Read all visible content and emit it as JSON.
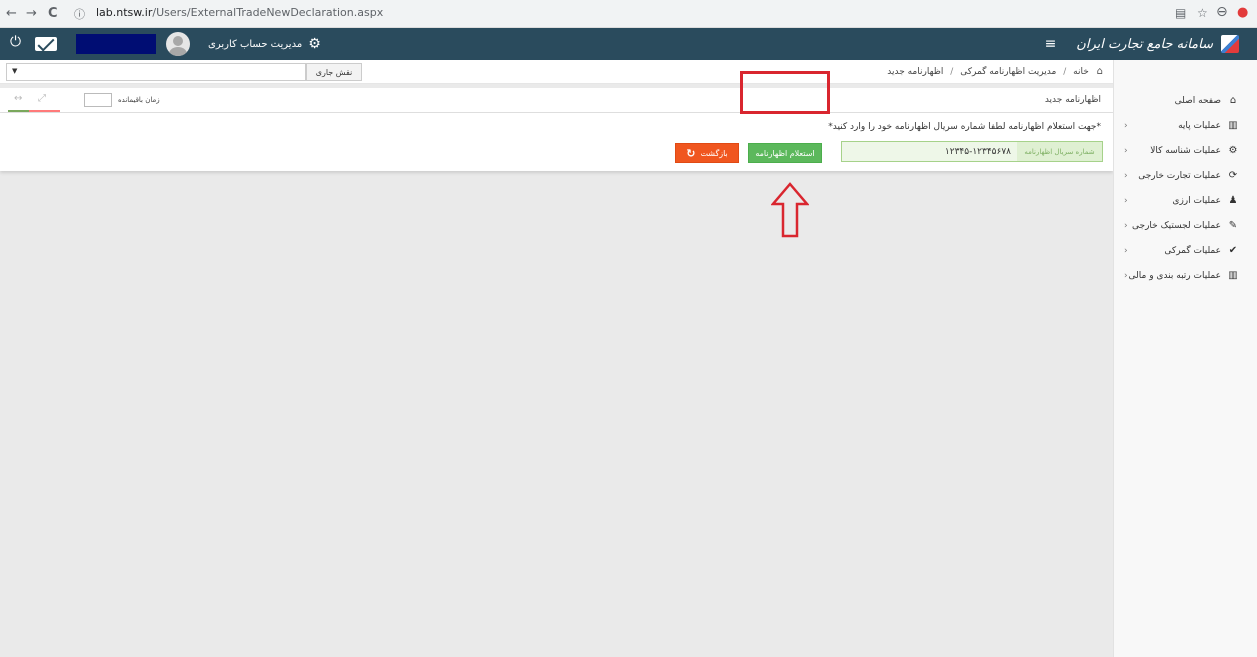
{
  "browser": {
    "url_host": "lab.ntsw.ir",
    "url_path": "/Users/ExternalTradeNewDeclaration.aspx",
    "back_icon": "←",
    "forward_icon": "→",
    "reload_icon": "C",
    "info_icon": "ⓘ",
    "translate_icon": "▤",
    "star_icon": "☆",
    "profile_icon": "⊖",
    "ext_icon": "●"
  },
  "topbar": {
    "brand_name": "سامانه جامع تجارت ایران",
    "hamburger_icon": "≡",
    "account_label": "مدیریت حساب کاربری",
    "gear_icon": "⚙",
    "power_icon": "⏻"
  },
  "breadcrumb": {
    "home_icon": "⌂",
    "items": [
      "خانه",
      "مدیریت اظهارنامه گمرکی",
      "اظهارنامه جدید"
    ],
    "separator": "/"
  },
  "role": {
    "label": "نقش جاری",
    "caret": "▼",
    "value": ""
  },
  "page": {
    "title": "اظهارنامه جدید",
    "timer_label": "زمان باقیمانده",
    "timer_value": "",
    "expand_icon": "⤢",
    "collapse_icon": "↔"
  },
  "form": {
    "instruction": "*جهت استعلام اظهارنامه لطفا شماره سریال اظهارنامه خود را وارد کنید*",
    "serial_label": "شماره سریال اظهارنامه",
    "serial_value": "۱۲۳۴۵-۱۲۳۴۵۶۷۸",
    "inquiry_button": "استعلام اظهارنامه",
    "back_button": "بازگشت",
    "refresh_icon": "↻"
  },
  "sidebar": {
    "chevron": "‹",
    "items": [
      {
        "label": "صفحه اصلی",
        "icon": "⌂",
        "has_chevron": false
      },
      {
        "label": "عملیات پایه",
        "icon": "▥",
        "has_chevron": true
      },
      {
        "label": "عملیات شناسه کالا",
        "icon": "⚙",
        "has_chevron": true
      },
      {
        "label": "عملیات تجارت خارجی",
        "icon": "⟳",
        "has_chevron": true
      },
      {
        "label": "عملیات ارزی",
        "icon": "♟",
        "has_chevron": true
      },
      {
        "label": "عملیات لجستیک خارجی",
        "icon": "✎",
        "has_chevron": true
      },
      {
        "label": "عملیات گمرکی",
        "icon": "✔",
        "has_chevron": true
      },
      {
        "label": "عملیات رتبه بندی و مالی",
        "icon": "▥",
        "has_chevron": true
      }
    ]
  },
  "colors": {
    "topbar": "#2a4b5d",
    "success": "#5cb85c",
    "danger_button": "#f0561f",
    "annotation_red": "#d9262f"
  }
}
